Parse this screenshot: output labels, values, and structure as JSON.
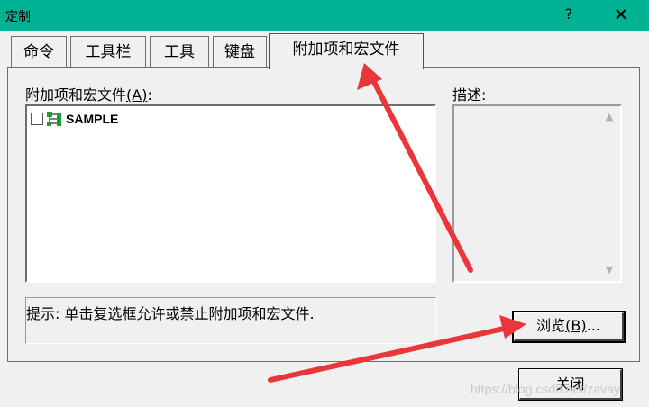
{
  "window": {
    "title": "定制",
    "help_label": "?",
    "close_label": "✕"
  },
  "tabs": [
    {
      "label": "命令",
      "active": false
    },
    {
      "label": "工具栏",
      "active": false
    },
    {
      "label": "工具",
      "active": false
    },
    {
      "label": "键盘",
      "active": false
    },
    {
      "label": "附加项和宏文件",
      "active": true
    }
  ],
  "addins": {
    "list_label": "附加项和宏文件",
    "list_label_shortcut": "(A)",
    "list_label_colon": ":",
    "items": [
      {
        "label": "SAMPLE",
        "checked": false,
        "icon": "addin-network-icon"
      }
    ]
  },
  "description": {
    "label": "描述:",
    "value": ""
  },
  "hint": {
    "text": "提示: 单击复选框允许或禁止附加项和宏文件."
  },
  "buttons": {
    "browse_label": "浏览",
    "browse_shortcut": "(B)",
    "browse_suffix": "...",
    "close_label": "关闭"
  },
  "watermark": {
    "text": "https://blog.csdn.net/zavay"
  },
  "colors": {
    "titlebar": "#00b294",
    "annotation_arrow": "#e8363b"
  }
}
